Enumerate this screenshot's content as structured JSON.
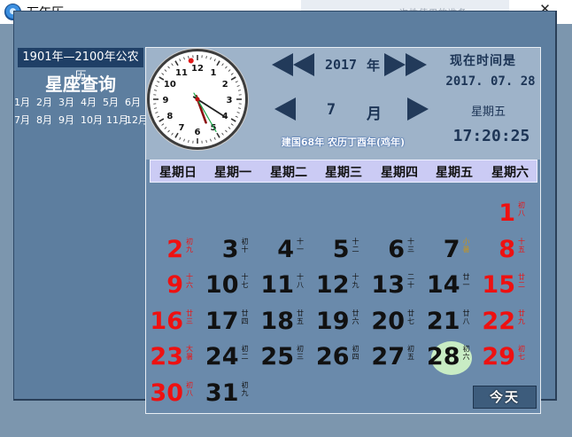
{
  "window": {
    "title": "万年历",
    "close": "✕",
    "background_text": "一次性使用的准备"
  },
  "left_panel": {
    "range_title": "1901年—2100年公农历",
    "zodiac_title": "星座查询",
    "months": [
      "1月",
      "2月",
      "3月",
      "4月",
      "5月",
      "6月",
      "7月",
      "8月",
      "9月",
      "10月",
      "11月",
      "12月"
    ]
  },
  "clock": {
    "hour": 5,
    "minute": 20,
    "second": 25,
    "numerals": [
      "12",
      "1",
      "2",
      "3",
      "4",
      "5",
      "6",
      "7",
      "8",
      "9",
      "10",
      "11"
    ]
  },
  "nav": {
    "year": "2017",
    "year_unit": "年",
    "month": "7",
    "month_unit": "月"
  },
  "now": {
    "label": "现在时间是",
    "date": "2017. 07. 28",
    "weekday": "星期五",
    "time": "17:20:25"
  },
  "lunar_line": "建国68年 农历丁酉年(鸡年)",
  "weekdays": [
    "星期日",
    "星期一",
    "星期二",
    "星期三",
    "星期四",
    "星期五",
    "星期六"
  ],
  "days": [
    {
      "d": "1",
      "l": "初八",
      "col": 6,
      "row": 0,
      "red": true
    },
    {
      "d": "2",
      "l": "初九",
      "col": 0,
      "row": 1,
      "red": true
    },
    {
      "d": "3",
      "l": "初十",
      "col": 1,
      "row": 1
    },
    {
      "d": "4",
      "l": "十一",
      "col": 2,
      "row": 1
    },
    {
      "d": "5",
      "l": "十二",
      "col": 3,
      "row": 1
    },
    {
      "d": "6",
      "l": "十三",
      "col": 4,
      "row": 1
    },
    {
      "d": "7",
      "l": "小暑",
      "col": 5,
      "row": 1,
      "gold": true
    },
    {
      "d": "8",
      "l": "十五",
      "col": 6,
      "row": 1,
      "red": true
    },
    {
      "d": "9",
      "l": "十六",
      "col": 0,
      "row": 2,
      "red": true
    },
    {
      "d": "10",
      "l": "十七",
      "col": 1,
      "row": 2
    },
    {
      "d": "11",
      "l": "十八",
      "col": 2,
      "row": 2
    },
    {
      "d": "12",
      "l": "十九",
      "col": 3,
      "row": 2
    },
    {
      "d": "13",
      "l": "二十",
      "col": 4,
      "row": 2
    },
    {
      "d": "14",
      "l": "廿一",
      "col": 5,
      "row": 2
    },
    {
      "d": "15",
      "l": "廿二",
      "col": 6,
      "row": 2,
      "red": true
    },
    {
      "d": "16",
      "l": "廿三",
      "col": 0,
      "row": 3,
      "red": true
    },
    {
      "d": "17",
      "l": "廿四",
      "col": 1,
      "row": 3
    },
    {
      "d": "18",
      "l": "廿五",
      "col": 2,
      "row": 3
    },
    {
      "d": "19",
      "l": "廿六",
      "col": 3,
      "row": 3
    },
    {
      "d": "20",
      "l": "廿七",
      "col": 4,
      "row": 3
    },
    {
      "d": "21",
      "l": "廿八",
      "col": 5,
      "row": 3
    },
    {
      "d": "22",
      "l": "廿九",
      "col": 6,
      "row": 3,
      "red": true
    },
    {
      "d": "23",
      "l": "大暑",
      "col": 0,
      "row": 4,
      "red": true
    },
    {
      "d": "24",
      "l": "初二",
      "col": 1,
      "row": 4
    },
    {
      "d": "25",
      "l": "初三",
      "col": 2,
      "row": 4
    },
    {
      "d": "26",
      "l": "初四",
      "col": 3,
      "row": 4
    },
    {
      "d": "27",
      "l": "初五",
      "col": 4,
      "row": 4
    },
    {
      "d": "28",
      "l": "初六",
      "col": 5,
      "row": 4,
      "today": true
    },
    {
      "d": "29",
      "l": "初七",
      "col": 6,
      "row": 4,
      "red": true
    },
    {
      "d": "30",
      "l": "初八",
      "col": 0,
      "row": 5,
      "red": true
    },
    {
      "d": "31",
      "l": "初九",
      "col": 1,
      "row": 5
    }
  ],
  "today_button": "今天",
  "colors": {
    "frame": "#7c96ae",
    "panel": "#5d7e9f",
    "weekday_bar": "#cbcbf4",
    "weekend_red": "#ee1111",
    "today_highlight": "#c8ecc4"
  }
}
